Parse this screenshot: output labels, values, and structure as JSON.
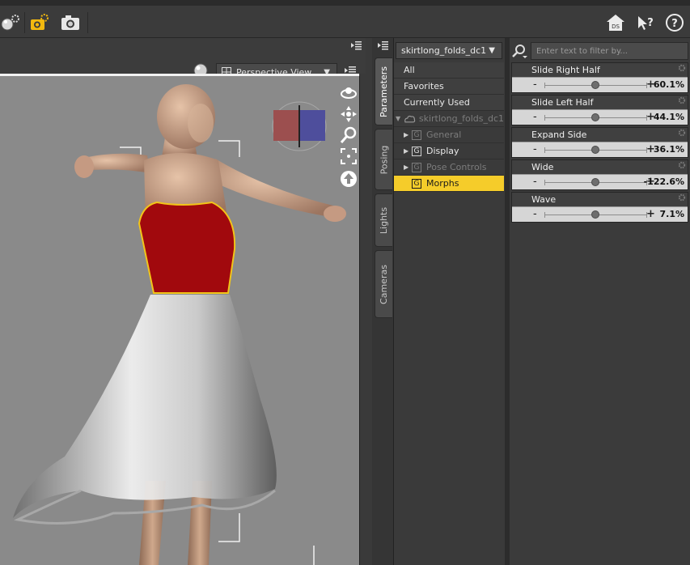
{
  "toolbar": {
    "icons": [
      "render-settings-icon",
      "render-icon",
      "camera-icon",
      "home-icon",
      "whats-this-icon",
      "help-icon"
    ],
    "home_badge": "DS",
    "whats_this": "?",
    "help": "?"
  },
  "viewport": {
    "camera_label": "Perspective View",
    "nav_icons": [
      "orbit-icon",
      "pan-icon",
      "zoom-icon",
      "frame-icon",
      "reset-view-icon"
    ]
  },
  "side_tabs": [
    {
      "label": "Parameters",
      "active": true
    },
    {
      "label": "Posing",
      "active": false
    },
    {
      "label": "Lights",
      "active": false
    },
    {
      "label": "Cameras",
      "active": false
    }
  ],
  "tree": {
    "selected_node": "skirtlong_folds_dc1",
    "flat_items": [
      "All",
      "Favorites",
      "Currently Used"
    ],
    "node_label": "skirtlong_folds_dc1",
    "groups": [
      {
        "label": "General",
        "dim": true,
        "expandable": true,
        "selected": false
      },
      {
        "label": "Display",
        "dim": false,
        "expandable": true,
        "selected": false
      },
      {
        "label": "Pose Controls",
        "dim": true,
        "expandable": true,
        "selected": false
      },
      {
        "label": "Morphs",
        "dim": false,
        "expandable": false,
        "selected": true
      }
    ],
    "group_glyph": "G"
  },
  "params": {
    "filter_placeholder": "Enter text to filter by...",
    "sliders": [
      {
        "name": "Slide Right Half",
        "value": "60.1%",
        "knob": 0.5
      },
      {
        "name": "Slide Left Half",
        "value": "44.1%",
        "knob": 0.5
      },
      {
        "name": "Expand Side",
        "value": "36.1%",
        "knob": 0.5
      },
      {
        "name": "Wide",
        "value": "-122.6%",
        "knob": 0.5
      },
      {
        "name": "Wave",
        "value": "7.1%",
        "knob": 0.5
      }
    ],
    "minus": "-",
    "plus": "+"
  },
  "colors": {
    "selection": "#f5cc2a",
    "viewport_bg": "#8a8a8a",
    "panel_bg": "#3b3b3b"
  }
}
